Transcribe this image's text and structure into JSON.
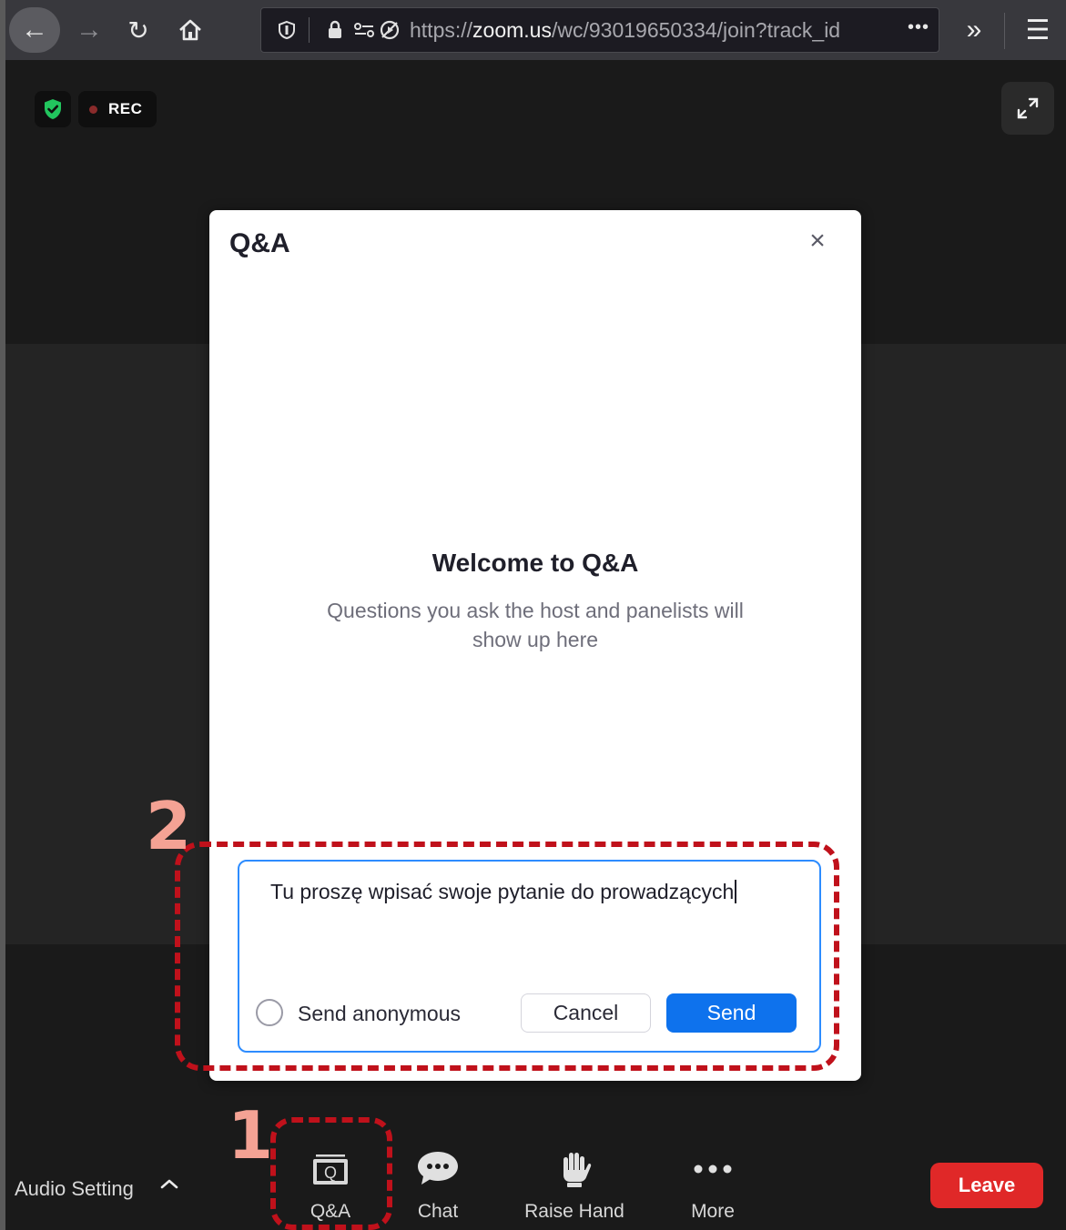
{
  "browser": {
    "url_prefix": "https://",
    "url_domain": "zoom.us",
    "url_path": "/wc/93019650334/join?track_id"
  },
  "meeting": {
    "rec_label": "REC",
    "colors": {
      "shield": "#22c55e",
      "rec_dot": "#8a2b2b"
    }
  },
  "qa_dialog": {
    "title": "Q&A",
    "welcome_title": "Welcome to Q&A",
    "welcome_subtitle": "Questions you ask the host and panelists will show up here",
    "compose_value": "Tu proszę wpisać swoje pytanie do prowadzących",
    "anonymous_label": "Send anonymous",
    "cancel_label": "Cancel",
    "send_label": "Send"
  },
  "toolbar": {
    "audio_label": "Audio Setting",
    "qa_label": "Q&A",
    "qa_icon_letter": "Q",
    "chat_label": "Chat",
    "raise_hand_label": "Raise Hand",
    "more_label": "More",
    "leave_label": "Leave"
  },
  "annotations": {
    "step1": "1",
    "step2": "2",
    "color": "#c0111b"
  }
}
